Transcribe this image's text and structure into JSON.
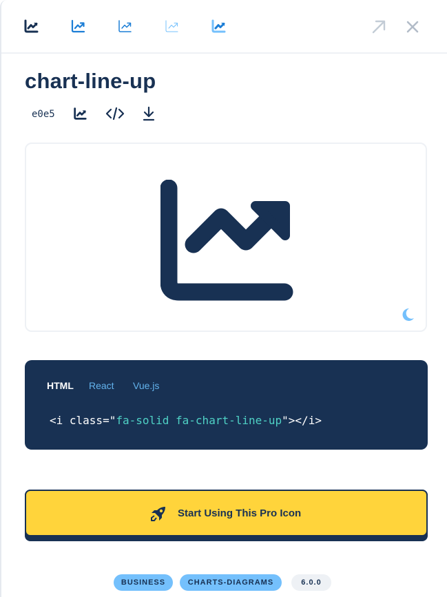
{
  "icon": {
    "name": "chart-line-up",
    "unicode": "e0e5"
  },
  "style_switcher": [
    {
      "name": "solid",
      "color": "#183153"
    },
    {
      "name": "regular",
      "color": "#1c7ed6"
    },
    {
      "name": "light",
      "color": "#1c7ed6"
    },
    {
      "name": "thin",
      "color": "#74c0fc"
    },
    {
      "name": "duotone",
      "color": "#1c7ed6"
    }
  ],
  "code": {
    "tabs": [
      "HTML",
      "React",
      "Vue.js"
    ],
    "active_tab": "HTML",
    "prefix": "<i class=\"",
    "class_value": "fa-solid fa-chart-line-up",
    "suffix": "\"></i>"
  },
  "cta": {
    "label": "Start Using This Pro Icon"
  },
  "tags": {
    "business": "BUSINESS",
    "charts": "CHARTS-DIAGRAMS",
    "version": "6.0.0"
  },
  "colors": {
    "navy": "#183153",
    "yellow": "#ffd43b",
    "blue": "#74c0fc",
    "teal": "#4fd1c5"
  }
}
